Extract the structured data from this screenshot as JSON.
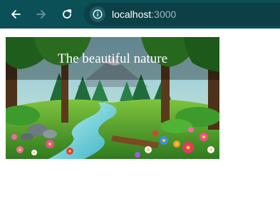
{
  "browser": {
    "url_host": "localhost",
    "url_port": ":3000",
    "icons": {
      "back": "arrow-left-icon",
      "forward": "arrow-right-icon",
      "reload": "reload-icon",
      "site_info": "site-info-icon"
    },
    "colors": {
      "toolbar": "#0b4f57",
      "omnibox": "#0d3f46",
      "text": "#ffffff",
      "muted": "#9bb7bb"
    }
  },
  "page": {
    "hero_title": "The beautiful nature"
  }
}
